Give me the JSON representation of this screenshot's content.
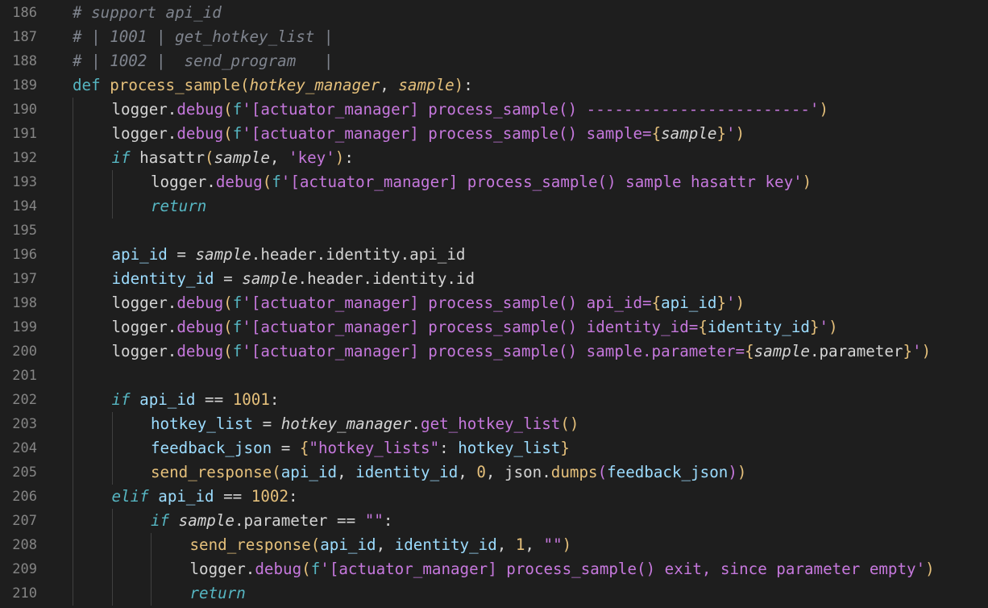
{
  "editor": {
    "background": "#1e1e1e",
    "lines": [
      {
        "num": "186",
        "indent": 0,
        "tokens": [
          [
            "comment",
            "# support api_id"
          ]
        ]
      },
      {
        "num": "187",
        "indent": 0,
        "tokens": [
          [
            "comment",
            "# | 1001 | get_hotkey_list |"
          ]
        ]
      },
      {
        "num": "188",
        "indent": 0,
        "tokens": [
          [
            "comment",
            "# | 1002 |  send_program   |"
          ]
        ]
      },
      {
        "num": "189",
        "indent": 0,
        "tokens": [
          [
            "kw",
            "def "
          ],
          [
            "fn",
            "process_sample"
          ],
          [
            "bracket1",
            "("
          ],
          [
            "param",
            "hotkey_manager"
          ],
          [
            "plain",
            ", "
          ],
          [
            "param",
            "sample"
          ],
          [
            "bracket1",
            ")"
          ],
          [
            "plain",
            ":"
          ]
        ]
      },
      {
        "num": "190",
        "indent": 1,
        "tokens": [
          [
            "plain",
            "logger."
          ],
          [
            "method",
            "debug"
          ],
          [
            "bracket1",
            "("
          ],
          [
            "kw",
            "f"
          ],
          [
            "str",
            "'[actuator_manager] process_sample() ------------------------'"
          ],
          [
            "bracket1",
            ")"
          ]
        ]
      },
      {
        "num": "191",
        "indent": 1,
        "tokens": [
          [
            "plain",
            "logger."
          ],
          [
            "method",
            "debug"
          ],
          [
            "bracket1",
            "("
          ],
          [
            "kw",
            "f"
          ],
          [
            "str",
            "'[actuator_manager] process_sample() sample="
          ],
          [
            "bracket1",
            "{"
          ],
          [
            "italic",
            "sample"
          ],
          [
            "bracket1",
            "}"
          ],
          [
            "str",
            "'"
          ],
          [
            "bracket1",
            ")"
          ]
        ]
      },
      {
        "num": "192",
        "indent": 1,
        "tokens": [
          [
            "kwi",
            "if "
          ],
          [
            "builtin",
            "hasattr"
          ],
          [
            "bracket1",
            "("
          ],
          [
            "italic",
            "sample"
          ],
          [
            "plain",
            ", "
          ],
          [
            "str",
            "'key'"
          ],
          [
            "bracket1",
            ")"
          ],
          [
            "plain",
            ":"
          ]
        ]
      },
      {
        "num": "193",
        "indent": 2,
        "tokens": [
          [
            "plain",
            "logger."
          ],
          [
            "method",
            "debug"
          ],
          [
            "bracket1",
            "("
          ],
          [
            "kw",
            "f"
          ],
          [
            "str",
            "'[actuator_manager] process_sample() sample hasattr key'"
          ],
          [
            "bracket1",
            ")"
          ]
        ]
      },
      {
        "num": "194",
        "indent": 2,
        "tokens": [
          [
            "kwi",
            "return"
          ]
        ]
      },
      {
        "num": "195",
        "indent": 1,
        "tokens": []
      },
      {
        "num": "196",
        "indent": 1,
        "tokens": [
          [
            "var",
            "api_id"
          ],
          [
            "plain",
            " = "
          ],
          [
            "italic",
            "sample"
          ],
          [
            "plain",
            ".header.identity.api_id"
          ]
        ]
      },
      {
        "num": "197",
        "indent": 1,
        "tokens": [
          [
            "var",
            "identity_id"
          ],
          [
            "plain",
            " = "
          ],
          [
            "italic",
            "sample"
          ],
          [
            "plain",
            ".header.identity.id"
          ]
        ]
      },
      {
        "num": "198",
        "indent": 1,
        "tokens": [
          [
            "plain",
            "logger."
          ],
          [
            "method",
            "debug"
          ],
          [
            "bracket1",
            "("
          ],
          [
            "kw",
            "f"
          ],
          [
            "str",
            "'[actuator_manager] process_sample() api_id="
          ],
          [
            "bracket1",
            "{"
          ],
          [
            "var",
            "api_id"
          ],
          [
            "bracket1",
            "}"
          ],
          [
            "str",
            "'"
          ],
          [
            "bracket1",
            ")"
          ]
        ]
      },
      {
        "num": "199",
        "indent": 1,
        "tokens": [
          [
            "plain",
            "logger."
          ],
          [
            "method",
            "debug"
          ],
          [
            "bracket1",
            "("
          ],
          [
            "kw",
            "f"
          ],
          [
            "str",
            "'[actuator_manager] process_sample() identity_id="
          ],
          [
            "bracket1",
            "{"
          ],
          [
            "var",
            "identity_id"
          ],
          [
            "bracket1",
            "}"
          ],
          [
            "str",
            "'"
          ],
          [
            "bracket1",
            ")"
          ]
        ]
      },
      {
        "num": "200",
        "indent": 1,
        "tokens": [
          [
            "plain",
            "logger."
          ],
          [
            "method",
            "debug"
          ],
          [
            "bracket1",
            "("
          ],
          [
            "kw",
            "f"
          ],
          [
            "str",
            "'[actuator_manager] process_sample() sample.parameter="
          ],
          [
            "bracket1",
            "{"
          ],
          [
            "italic",
            "sample"
          ],
          [
            "plain",
            ".parameter"
          ],
          [
            "bracket1",
            "}"
          ],
          [
            "str",
            "'"
          ],
          [
            "bracket1",
            ")"
          ]
        ]
      },
      {
        "num": "201",
        "indent": 1,
        "tokens": []
      },
      {
        "num": "202",
        "indent": 1,
        "tokens": [
          [
            "kwi",
            "if "
          ],
          [
            "var",
            "api_id"
          ],
          [
            "plain",
            " == "
          ],
          [
            "num",
            "1001"
          ],
          [
            "plain",
            ":"
          ]
        ]
      },
      {
        "num": "203",
        "indent": 2,
        "tokens": [
          [
            "var",
            "hotkey_list"
          ],
          [
            "plain",
            " = "
          ],
          [
            "italic",
            "hotkey_manager"
          ],
          [
            "plain",
            "."
          ],
          [
            "method",
            "get_hotkey_list"
          ],
          [
            "bracket1",
            "()"
          ]
        ]
      },
      {
        "num": "204",
        "indent": 2,
        "tokens": [
          [
            "var",
            "feedback_json"
          ],
          [
            "plain",
            " = "
          ],
          [
            "bracket1",
            "{"
          ],
          [
            "str",
            "\"hotkey_lists\""
          ],
          [
            "plain",
            ": "
          ],
          [
            "var",
            "hotkey_list"
          ],
          [
            "bracket1",
            "}"
          ]
        ]
      },
      {
        "num": "205",
        "indent": 2,
        "tokens": [
          [
            "fn",
            "send_response"
          ],
          [
            "bracket1",
            "("
          ],
          [
            "var",
            "api_id"
          ],
          [
            "plain",
            ", "
          ],
          [
            "var",
            "identity_id"
          ],
          [
            "plain",
            ", "
          ],
          [
            "num",
            "0"
          ],
          [
            "plain",
            ", json."
          ],
          [
            "fn",
            "dumps"
          ],
          [
            "bracket2",
            "("
          ],
          [
            "var",
            "feedback_json"
          ],
          [
            "bracket2",
            ")"
          ],
          [
            "bracket1",
            ")"
          ]
        ]
      },
      {
        "num": "206",
        "indent": 1,
        "tokens": [
          [
            "kwi",
            "elif "
          ],
          [
            "var",
            "api_id"
          ],
          [
            "plain",
            " == "
          ],
          [
            "num",
            "1002"
          ],
          [
            "plain",
            ":"
          ]
        ]
      },
      {
        "num": "207",
        "indent": 2,
        "tokens": [
          [
            "kwi",
            "if "
          ],
          [
            "italic",
            "sample"
          ],
          [
            "plain",
            ".parameter == "
          ],
          [
            "str",
            "\"\""
          ],
          [
            "plain",
            ":"
          ]
        ]
      },
      {
        "num": "208",
        "indent": 3,
        "tokens": [
          [
            "fn",
            "send_response"
          ],
          [
            "bracket1",
            "("
          ],
          [
            "var",
            "api_id"
          ],
          [
            "plain",
            ", "
          ],
          [
            "var",
            "identity_id"
          ],
          [
            "plain",
            ", "
          ],
          [
            "num",
            "1"
          ],
          [
            "plain",
            ", "
          ],
          [
            "str",
            "\"\""
          ],
          [
            "bracket1",
            ")"
          ]
        ]
      },
      {
        "num": "209",
        "indent": 3,
        "tokens": [
          [
            "plain",
            "logger."
          ],
          [
            "method",
            "debug"
          ],
          [
            "bracket1",
            "("
          ],
          [
            "kw",
            "f"
          ],
          [
            "str",
            "'[actuator_manager] process_sample() exit, since parameter empty'"
          ],
          [
            "bracket1",
            ")"
          ]
        ]
      },
      {
        "num": "210",
        "indent": 3,
        "tokens": [
          [
            "kwi",
            "return"
          ]
        ]
      }
    ]
  }
}
